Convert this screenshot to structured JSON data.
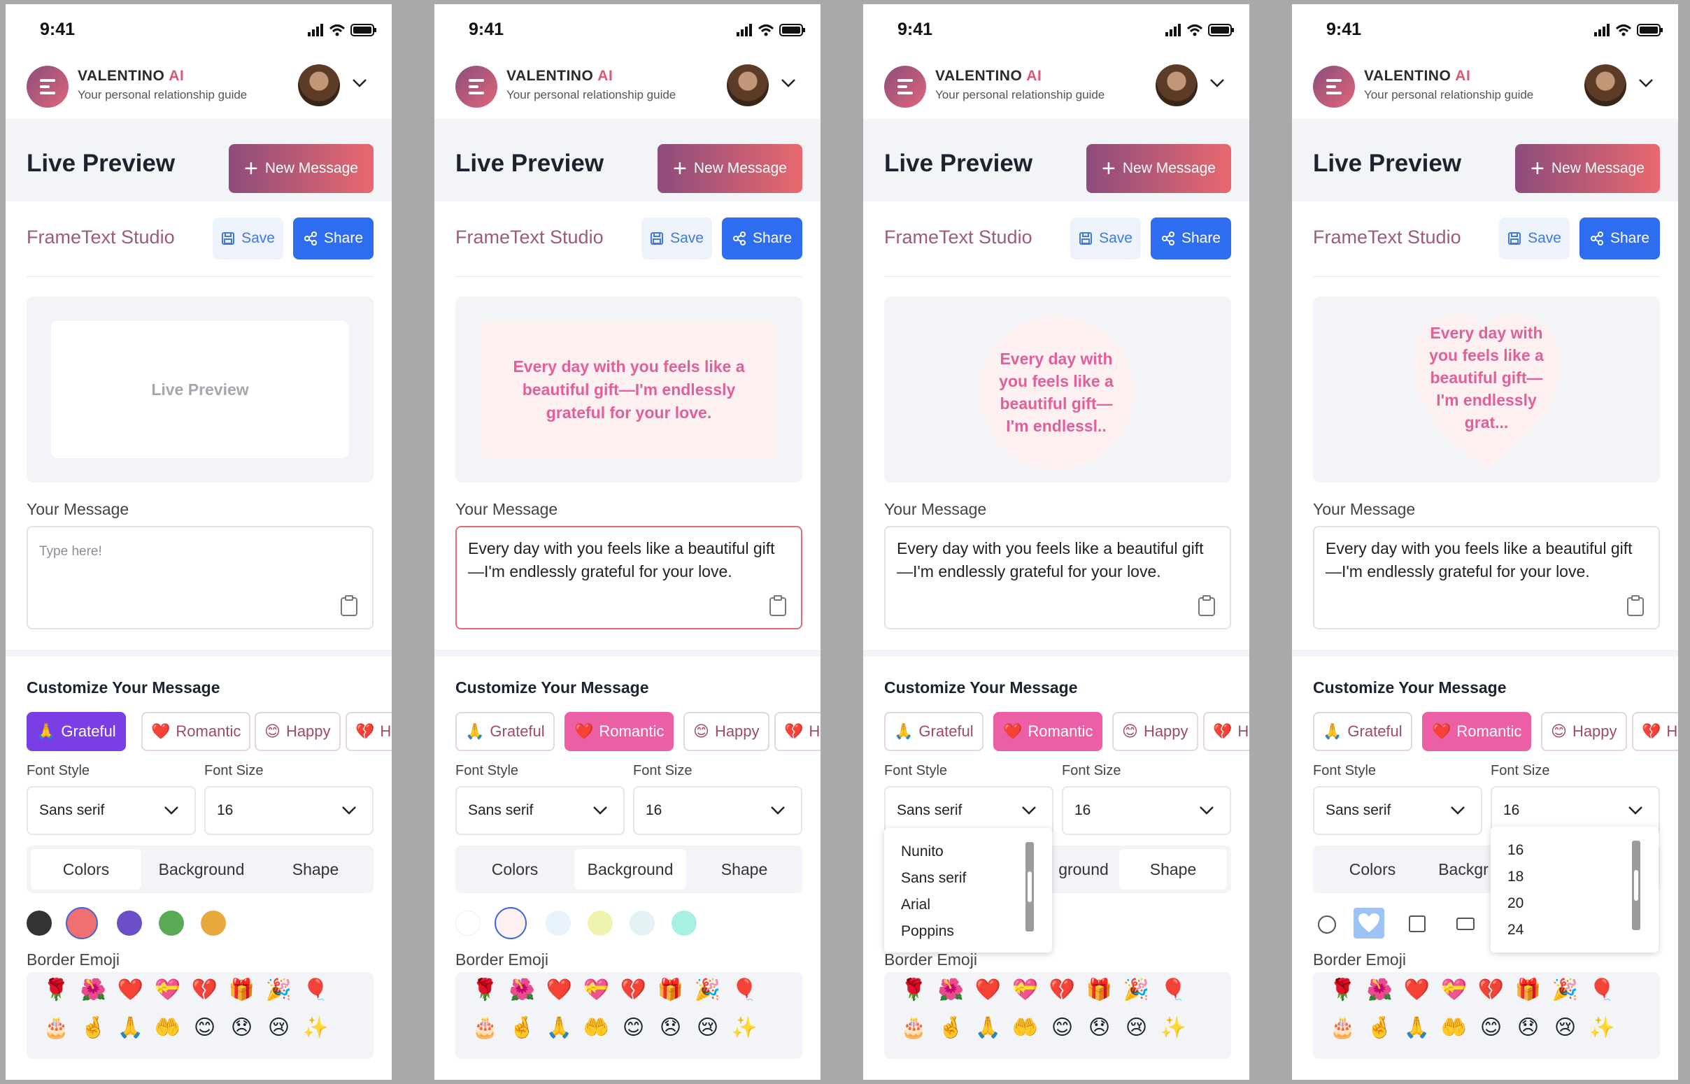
{
  "status": {
    "time": "9:41"
  },
  "header": {
    "brand_main": "VALENTINO",
    "brand_accent": "AI",
    "tagline": "Your personal relationship guide"
  },
  "hero": {
    "title": "Live Preview",
    "new_message": "New Message"
  },
  "studio": {
    "title": "FrameText Studio",
    "save": "Save",
    "share": "Share"
  },
  "preview": {
    "placeholder": "Live Preview",
    "text_full": "Every day with you feels like a beautiful gift—I'm endlessly grateful for your love.",
    "text_circle": "Every day with you feels like a beautiful gift—I'm endlessl..",
    "text_heart": "Every day with you feels like a beautiful gift—I'm endlessly grat..."
  },
  "message": {
    "label": "Your Message",
    "placeholder": "Type here!",
    "value": "Every day with you feels like a beautiful gift—I'm endlessly grateful for your love."
  },
  "customize": {
    "title": "Customize Your Message",
    "moods": [
      {
        "emoji": "🙏",
        "label": "Grateful"
      },
      {
        "emoji": "❤️",
        "label": "Romantic"
      },
      {
        "emoji": "😊",
        "label": "Happy"
      },
      {
        "emoji": "💔",
        "label": "He"
      }
    ],
    "font_style_label": "Font Style",
    "font_size_label": "Font Size",
    "font_style_value": "Sans serif",
    "font_size_value": "16",
    "tabs": [
      "Colors",
      "Background",
      "Shape"
    ],
    "border_emoji_label": "Border Emoji",
    "emoji_row1": [
      "🌹",
      "🌺",
      "❤️",
      "💝",
      "💔",
      "🎁",
      "🎉",
      "🎈"
    ],
    "emoji_row2": [
      "🎂",
      "🤞",
      "🙏",
      "🤲",
      "😊",
      "😞",
      "😢",
      "✨"
    ]
  },
  "text_colors": [
    "#333333",
    "#f07070",
    "#6a4fc8",
    "#5aaa55",
    "#e8a93c"
  ],
  "bg_colors": [
    "#ffffff",
    "#fdf0f1",
    "#e8f3fc",
    "#eef3b0",
    "#e4f2f3",
    "#a8f0e2"
  ],
  "font_style_options": [
    "Nunito",
    "Sans serif",
    "Arial",
    "Poppins"
  ],
  "font_size_options": [
    "16",
    "18",
    "20",
    "24"
  ],
  "tab_visible_fragments": {
    "background": "ground",
    "background_short": "Backgr"
  }
}
